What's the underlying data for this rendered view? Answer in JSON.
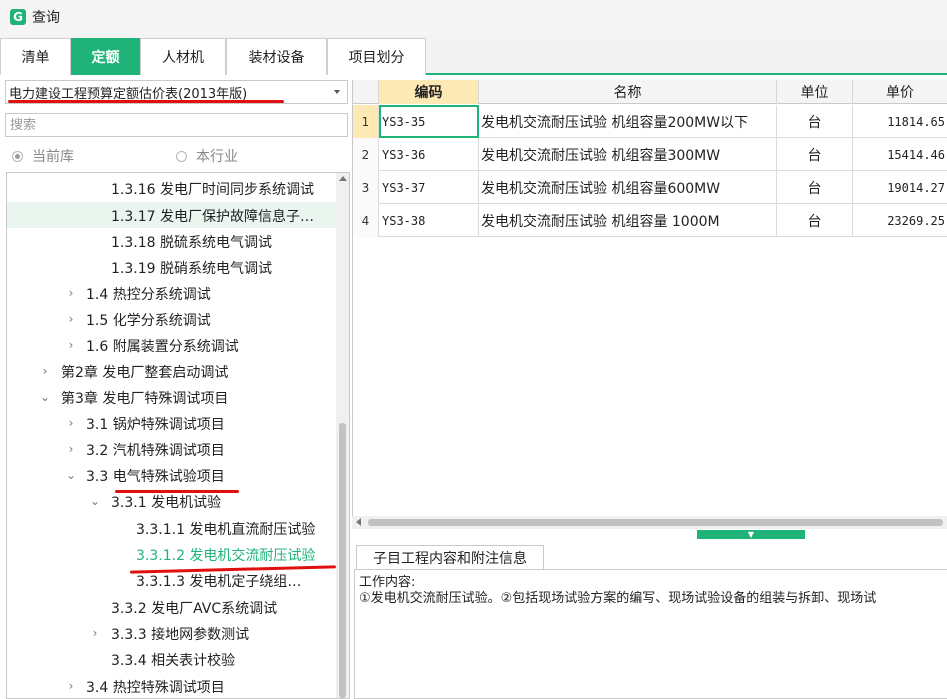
{
  "window": {
    "logo_letter": "G",
    "title": "查询"
  },
  "tabs": [
    {
      "label": "清单",
      "active": false
    },
    {
      "label": "定额",
      "active": true
    },
    {
      "label": "人材机",
      "active": false
    },
    {
      "label": "装材设备",
      "active": false
    },
    {
      "label": "项目划分",
      "active": false
    }
  ],
  "library": {
    "selected": "电力建设工程预算定额估价表(2013年版)",
    "search_placeholder": "搜索",
    "scope_options": [
      {
        "label": "当前库",
        "checked": true
      },
      {
        "label": "本行业",
        "checked": false
      }
    ]
  },
  "tree": {
    "items": [
      {
        "label": "1.3.16 发电厂时间同步系统调试",
        "arrow": ""
      },
      {
        "label": "1.3.17 发电厂保护故障信息子…",
        "arrow": ""
      },
      {
        "label": "1.3.18 脱硫系统电气调试",
        "arrow": ""
      },
      {
        "label": "1.3.19 脱硝系统电气调试",
        "arrow": ""
      },
      {
        "label": "1.4 热控分系统调试",
        "arrow": "›"
      },
      {
        "label": "1.5 化学分系统调试",
        "arrow": "›"
      },
      {
        "label": "1.6 附属装置分系统调试",
        "arrow": "›"
      },
      {
        "label": "第2章 发电厂整套启动调试",
        "arrow": "›"
      },
      {
        "label": "第3章 发电厂特殊调试项目",
        "arrow": "⌄"
      },
      {
        "label": "3.1 锅炉特殊调试项目",
        "arrow": "›"
      },
      {
        "label": "3.2 汽机特殊调试项目",
        "arrow": "›"
      },
      {
        "label": "3.3 电气特殊试验项目",
        "arrow": "⌄"
      },
      {
        "label": "3.3.1 发电机试验",
        "arrow": "⌄"
      },
      {
        "label": "3.3.1.1 发电机直流耐压试验",
        "arrow": ""
      },
      {
        "label": "3.3.1.2 发电机交流耐压试验",
        "arrow": ""
      },
      {
        "label": "3.3.1.3 发电机定子绕组…",
        "arrow": ""
      },
      {
        "label": "3.3.2 发电厂AVC系统调试",
        "arrow": ""
      },
      {
        "label": "3.3.3 接地网参数测试",
        "arrow": "›"
      },
      {
        "label": "3.3.4 相关表计校验",
        "arrow": ""
      },
      {
        "label": "3.4 热控特殊调试项目",
        "arrow": "›"
      }
    ]
  },
  "grid": {
    "columns": [
      "",
      "编码",
      "名称",
      "单位",
      "单价"
    ],
    "rows": [
      {
        "no": "1",
        "code": "YS3-35",
        "name": "发电机交流耐压试验 机组容量200MW以下",
        "unit": "台",
        "price": "11814.65"
      },
      {
        "no": "2",
        "code": "YS3-36",
        "name": "发电机交流耐压试验 机组容量300MW",
        "unit": "台",
        "price": "15414.46"
      },
      {
        "no": "3",
        "code": "YS3-37",
        "name": "发电机交流耐压试验 机组容量600MW",
        "unit": "台",
        "price": "19014.27"
      },
      {
        "no": "4",
        "code": "YS3-38",
        "name": "发电机交流耐压试验 机组容量 1000M",
        "unit": "台",
        "price": "23269.25"
      }
    ]
  },
  "info": {
    "tab_label": "子目工程内容和附注信息",
    "heading": "工作内容:",
    "body": "①发电机交流耐压试验。②包括现场试验方案的编写、现场试验设备的组装与拆卸、现场试"
  },
  "colors": {
    "accent": "#1fb37a",
    "pen": "#e01010",
    "header_active": "#fce9b4"
  }
}
